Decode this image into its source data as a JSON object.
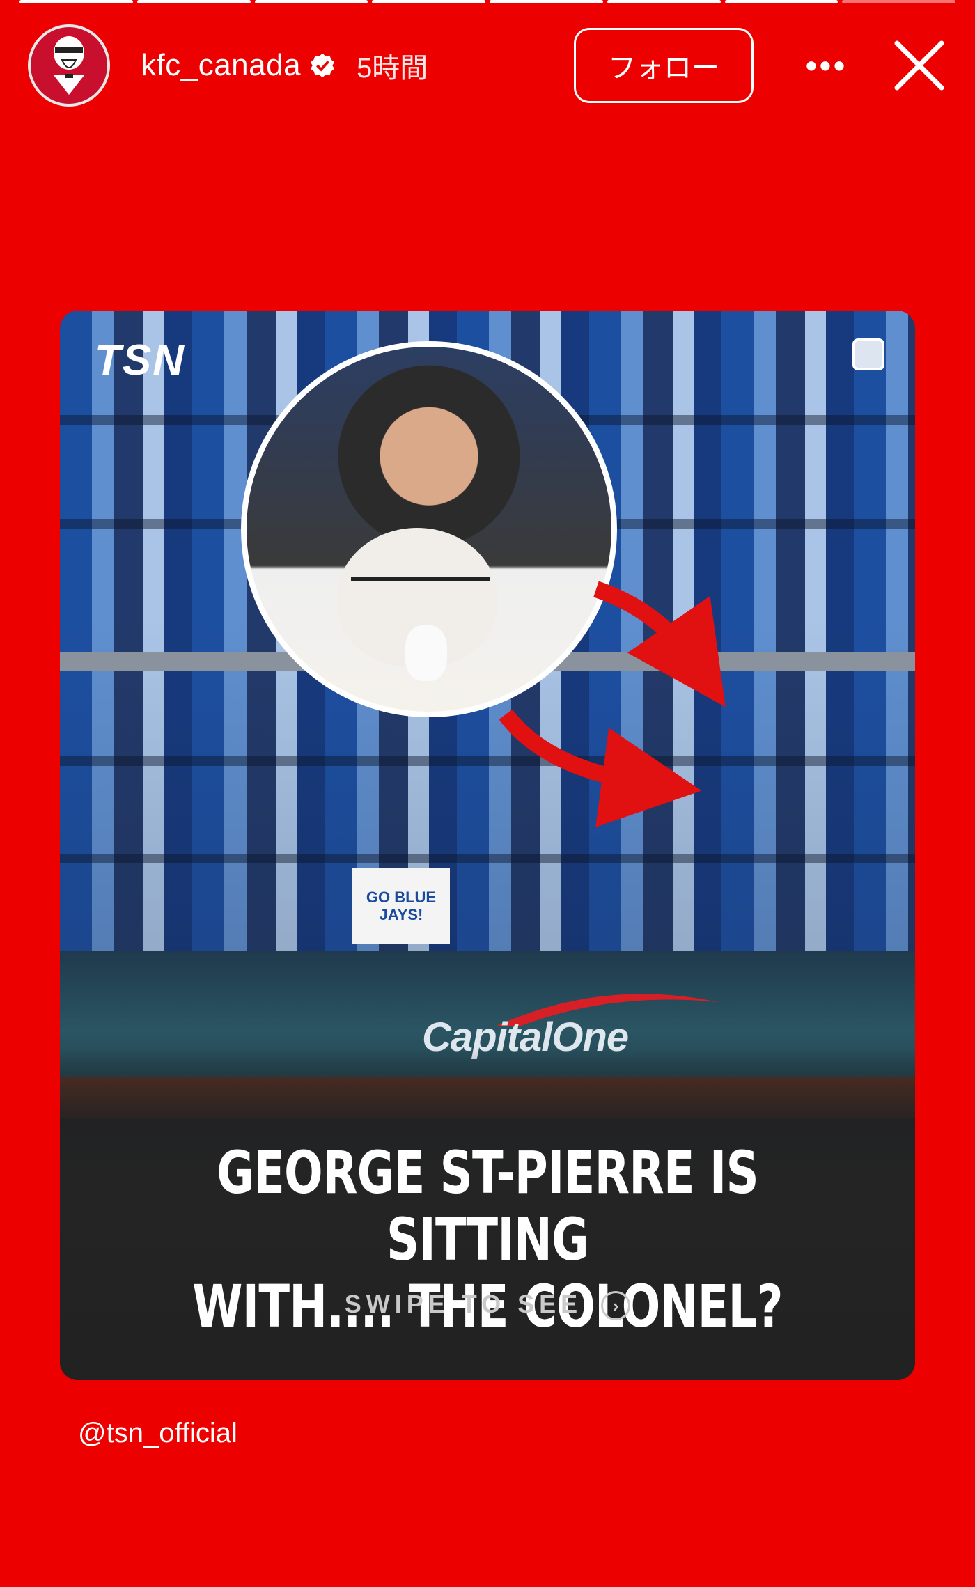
{
  "story": {
    "segments_total": 8,
    "segments_done": 7
  },
  "header": {
    "username": "kfc_canada",
    "time": "5時間",
    "follow_label": "フォロー",
    "more_label": "•••",
    "icons": {
      "avatar": "colonel-logo-icon",
      "verified": "verified-badge-icon",
      "close": "close-icon"
    }
  },
  "post": {
    "logo": "TSN",
    "sign_text": "GO BLUE JAYS!",
    "sponsor": "CapitalOne",
    "headline_line1": "GEORGE ST-PIERRE IS SITTING",
    "headline_line2": "WITH.... THE COLONEL?",
    "swipe_label": "SWIPE TO SEE",
    "swipe_icon": "›"
  },
  "mention": "@tsn_official",
  "colors": {
    "background": "#ec0000",
    "caption_bg": "#222222",
    "arrow": "#e11"
  }
}
